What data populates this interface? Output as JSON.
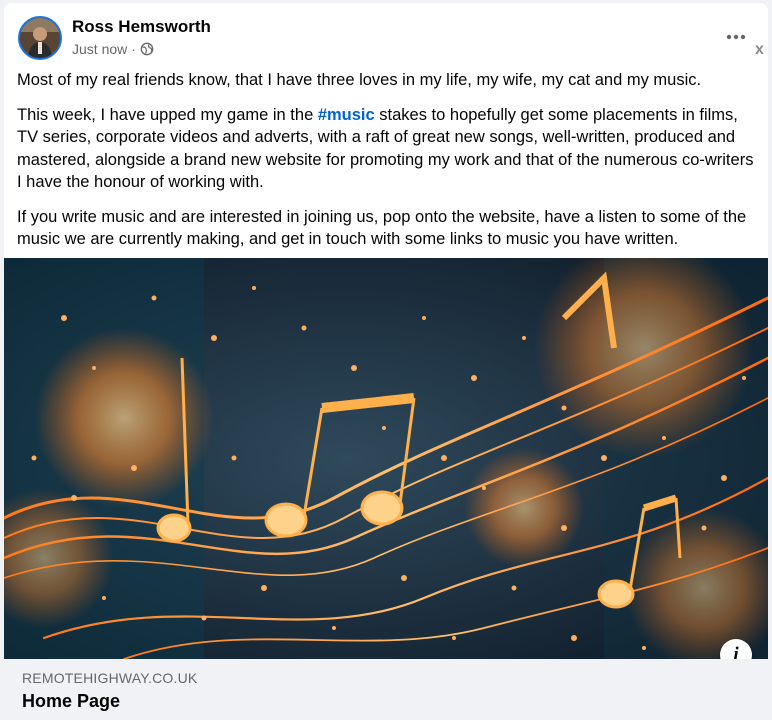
{
  "post": {
    "author": "Ross Hemsworth",
    "timestamp": "Just now",
    "privacy_icon": "globe-icon",
    "more_icon": "more-options-icon",
    "close_label": "x",
    "hashtag": "#music",
    "paragraphs": {
      "p1": "Most of my real friends know, that I have three loves in my life, my wife, my cat and my music.",
      "p2_before": "This week, I have upped my game in the ",
      "p2_after": " stakes to hopefully get some placements in films, TV series, corporate videos and adverts, with a raft of great new songs, well-written, produced and mastered, alongside a brand new website for promoting my work and that of the numerous co-writers I have the honour of working with.",
      "p3": "If you write music and are interested in joining us, pop onto the website, have a listen to some of the music we are currently making, and get in touch with some links to music you have written."
    },
    "link_preview": {
      "domain": "REMOTEHIGHWAY.CO.UK",
      "title": "Home Page",
      "info_label": "i"
    }
  },
  "colors": {
    "accent": "#1b74e4",
    "hashtag": "#0064d1",
    "secondary_text": "#65676b",
    "footer_bg": "#f0f2f5"
  }
}
